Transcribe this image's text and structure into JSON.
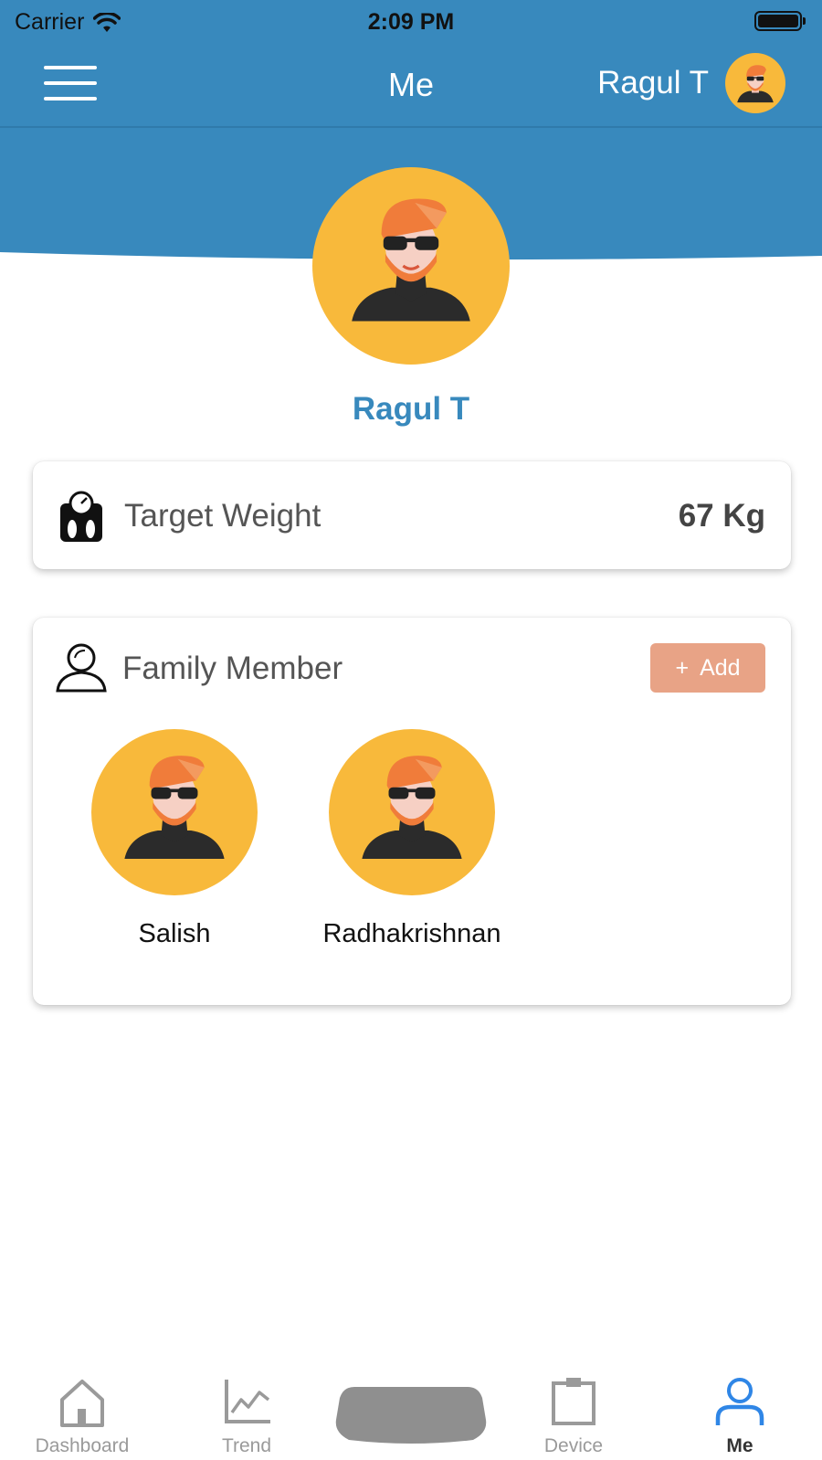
{
  "status_bar": {
    "carrier": "Carrier",
    "time": "2:09 PM"
  },
  "header": {
    "title": "Me",
    "user_name": "Ragul T"
  },
  "profile": {
    "name": "Ragul T"
  },
  "target_weight": {
    "label": "Target Weight",
    "value": "67 Kg"
  },
  "family": {
    "label": "Family Member",
    "add_label": "Add",
    "add_symbol": "+",
    "members": [
      {
        "name": "Salish"
      },
      {
        "name": "Radhakrishnan"
      }
    ]
  },
  "tabs": [
    {
      "label": "Dashboard",
      "icon": "home-icon"
    },
    {
      "label": "Trend",
      "icon": "line-chart-icon"
    },
    {
      "label": "",
      "icon": "scale-icon"
    },
    {
      "label": "Device",
      "icon": "device-icon"
    },
    {
      "label": "Me",
      "icon": "user-icon"
    }
  ],
  "colors": {
    "header_bg": "#3889bd",
    "avatar_bg": "#f8b93b",
    "add_button": "#e8a386",
    "active_tab": "#2f86e6",
    "name_accent": "#3889bd"
  }
}
